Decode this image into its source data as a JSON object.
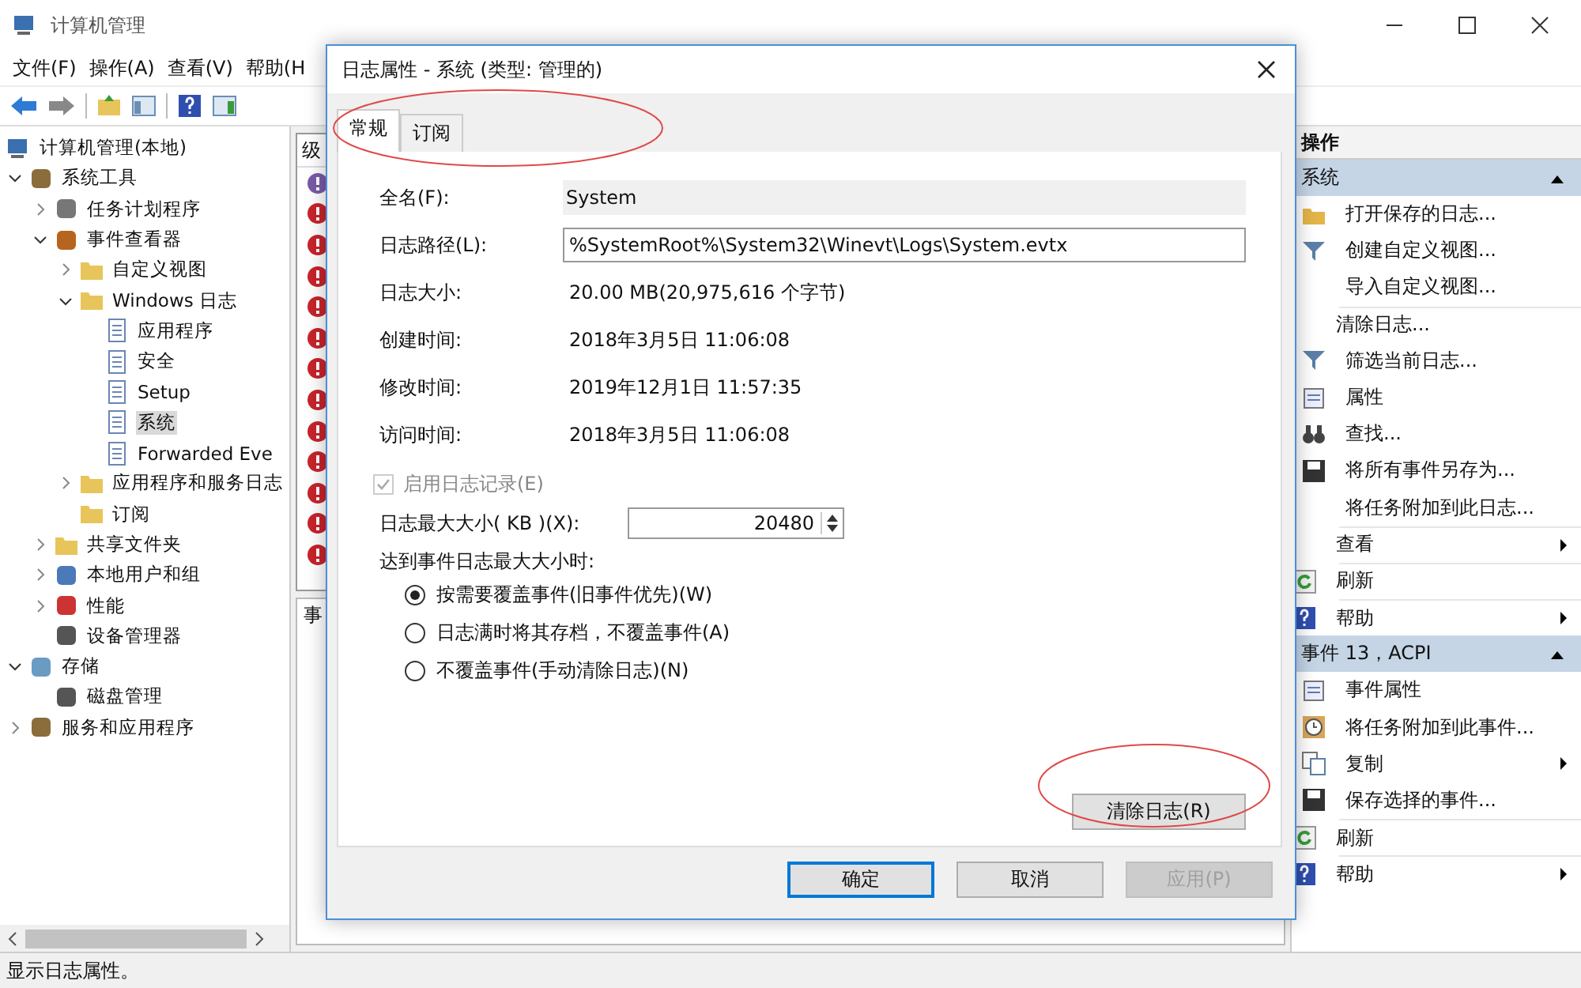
{
  "window": {
    "title": "计算机管理"
  },
  "menu": [
    "文件(F)",
    "操作(A)",
    "查看(V)",
    "帮助(H"
  ],
  "tree": {
    "root": "计算机管理(本地)",
    "children": [
      {
        "label": "系统工具",
        "kind": "tools",
        "expanded": true,
        "selected": false,
        "children": [
          {
            "label": "任务计划程序",
            "kind": "clock",
            "expanded": false,
            "selected": false
          },
          {
            "label": "事件查看器",
            "kind": "viewer",
            "expanded": true,
            "selected": false,
            "children": [
              {
                "label": "自定义视图",
                "kind": "folder",
                "expanded": false,
                "selected": false
              },
              {
                "label": "Windows 日志",
                "kind": "folder",
                "expanded": true,
                "selected": false,
                "children": [
                  {
                    "label": "应用程序",
                    "kind": "log",
                    "selected": false
                  },
                  {
                    "label": "安全",
                    "kind": "log",
                    "selected": false
                  },
                  {
                    "label": "Setup",
                    "kind": "log",
                    "selected": false
                  },
                  {
                    "label": "系统",
                    "kind": "log",
                    "selected": true
                  },
                  {
                    "label": "Forwarded Eve",
                    "kind": "log",
                    "selected": false
                  }
                ]
              },
              {
                "label": "应用程序和服务日志",
                "kind": "folder",
                "expanded": false,
                "selected": false
              },
              {
                "label": "订阅",
                "kind": "folder",
                "selected": false
              }
            ]
          },
          {
            "label": "共享文件夹",
            "kind": "folder",
            "expanded": false,
            "selected": false
          },
          {
            "label": "本地用户和组",
            "kind": "users",
            "expanded": false,
            "selected": false
          },
          {
            "label": "性能",
            "kind": "perf",
            "expanded": false,
            "selected": false
          },
          {
            "label": "设备管理器",
            "kind": "device",
            "selected": false
          }
        ]
      },
      {
        "label": "存储",
        "kind": "storage",
        "expanded": true,
        "selected": false,
        "children": [
          {
            "label": "磁盘管理",
            "kind": "device",
            "selected": false
          }
        ]
      },
      {
        "label": "服务和应用程序",
        "kind": "tools",
        "expanded": false,
        "selected": false
      }
    ]
  },
  "events": {
    "header": "级",
    "lower_header": "事",
    "rows": [
      {
        "kind": "error",
        "selected": true
      },
      {
        "kind": "error",
        "selected": false
      },
      {
        "kind": "error",
        "selected": false
      },
      {
        "kind": "error",
        "selected": false
      },
      {
        "kind": "error",
        "selected": false
      },
      {
        "kind": "error",
        "selected": false
      },
      {
        "kind": "error",
        "selected": false
      },
      {
        "kind": "error",
        "selected": false
      },
      {
        "kind": "error",
        "selected": false
      },
      {
        "kind": "error",
        "selected": false
      },
      {
        "kind": "error",
        "selected": false
      },
      {
        "kind": "error",
        "selected": false
      },
      {
        "kind": "error",
        "selected": false
      }
    ]
  },
  "actions": {
    "title": "操作",
    "sections": [
      {
        "title": "系统",
        "expanded": true,
        "items": [
          {
            "label": "打开保存的日志...",
            "kind": "folder",
            "separator_before": false,
            "submenu": false
          },
          {
            "label": "创建自定义视图...",
            "kind": "filter",
            "separator_before": false,
            "submenu": false
          },
          {
            "label": "导入自定义视图...",
            "kind": "plain",
            "separator_before": false,
            "submenu": false
          },
          {
            "label": "清除日志...",
            "kind": "plain",
            "separator_before": true,
            "submenu": false
          },
          {
            "label": "筛选当前日志...",
            "kind": "filter",
            "separator_before": false,
            "submenu": false
          },
          {
            "label": "属性",
            "kind": "props",
            "separator_before": false,
            "submenu": false
          },
          {
            "label": "查找...",
            "kind": "find",
            "separator_before": false,
            "submenu": false
          },
          {
            "label": "将所有事件另存为...",
            "kind": "save",
            "separator_before": false,
            "submenu": false
          },
          {
            "label": "将任务附加到此日志...",
            "kind": "plain",
            "separator_before": false,
            "submenu": false
          },
          {
            "label": "查看",
            "kind": "plain",
            "separator_before": true,
            "submenu": true
          },
          {
            "label": "刷新",
            "kind": "refresh",
            "separator_before": true,
            "submenu": false
          },
          {
            "label": "帮助",
            "kind": "help",
            "separator_before": true,
            "submenu": true
          }
        ]
      },
      {
        "title": "事件 13，ACPI",
        "expanded": true,
        "items": [
          {
            "label": "事件属性",
            "kind": "props",
            "separator_before": false,
            "submenu": false
          },
          {
            "label": "将任务附加到此事件...",
            "kind": "clock",
            "separator_before": false,
            "submenu": false
          },
          {
            "label": "复制",
            "kind": "copy",
            "separator_before": false,
            "submenu": true
          },
          {
            "label": "保存选择的事件...",
            "kind": "save",
            "separator_before": false,
            "submenu": false
          },
          {
            "label": "刷新",
            "kind": "refresh",
            "separator_before": true,
            "submenu": false
          },
          {
            "label": "帮助",
            "kind": "help",
            "separator_before": true,
            "submenu": true
          }
        ]
      }
    ]
  },
  "status_bar": "显示日志属性。",
  "dialog": {
    "title": "日志属性 - 系统 (类型: 管理的)",
    "tabs": [
      {
        "label": "常规",
        "selected": true
      },
      {
        "label": "订阅",
        "selected": false
      }
    ],
    "fields": [
      {
        "label": "全名(F):",
        "value": "System",
        "kind": "readonly"
      },
      {
        "label": "日志路径(L):",
        "value": "%SystemRoot%\\System32\\Winevt\\Logs\\System.evtx",
        "kind": "input"
      },
      {
        "label": "日志大小:",
        "value": "20.00 MB(20,975,616 个字节)",
        "kind": "text"
      },
      {
        "label": "创建时间:",
        "value": "2018年3月5日 11:06:08",
        "kind": "text"
      },
      {
        "label": "修改时间:",
        "value": "2019年12月1日 11:57:35",
        "kind": "text"
      },
      {
        "label": "访问时间:",
        "value": "2018年3月5日 11:06:08",
        "kind": "text"
      }
    ],
    "enable_logging": {
      "label": "启用日志记录(E)",
      "checked": true,
      "disabled": true
    },
    "max_size": {
      "label": "日志最大大小( KB )(X):",
      "value": "20480"
    },
    "policy_label": "达到事件日志最大大小时:",
    "policies": [
      {
        "label": "按需要覆盖事件(旧事件优先)(W)",
        "selected": true
      },
      {
        "label": "日志满时将其存档，不覆盖事件(A)",
        "selected": false
      },
      {
        "label": "不覆盖事件(手动清除日志)(N)",
        "selected": false
      }
    ],
    "clear_button": "清除日志(R)",
    "buttons": [
      {
        "label": "确定",
        "kind": "default",
        "disabled": false
      },
      {
        "label": "取消",
        "kind": "normal",
        "disabled": false
      },
      {
        "label": "应用(P)",
        "kind": "normal",
        "disabled": true
      }
    ]
  }
}
